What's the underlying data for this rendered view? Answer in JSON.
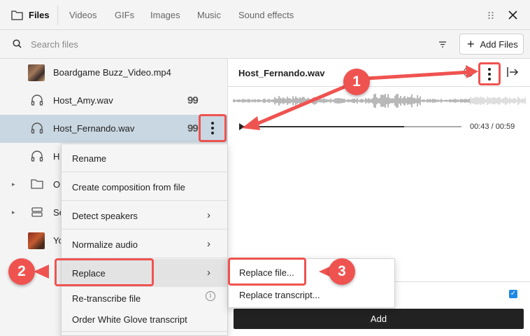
{
  "tabs": [
    {
      "label": "Files"
    },
    {
      "label": "Videos"
    },
    {
      "label": "GIFs"
    },
    {
      "label": "Images"
    },
    {
      "label": "Music"
    },
    {
      "label": "Sound effects"
    }
  ],
  "search": {
    "placeholder": "Search files"
  },
  "add_files_label": "Add Files",
  "files": [
    {
      "name": "Boardgame Buzz_Video.mp4",
      "type": "video-thumb"
    },
    {
      "name": "Host_Amy.wav",
      "type": "audio",
      "badge": "99"
    },
    {
      "name": "Host_Fernando.wav",
      "type": "audio",
      "badge": "99",
      "selected": true
    },
    {
      "name": "H",
      "type": "audio"
    },
    {
      "name": "O",
      "type": "folder"
    },
    {
      "name": "Se",
      "type": "sequence"
    },
    {
      "name": "Yo",
      "type": "video-thumb"
    }
  ],
  "detail": {
    "title": "Host_Fernando.wav",
    "timecode": "00:43 / 00:59",
    "progress": 0.74,
    "add_label": "Add"
  },
  "context_menu": {
    "items": [
      {
        "label": "Rename"
      },
      {
        "label": "Create composition from file"
      },
      {
        "label": "Detect speakers",
        "chevron": true
      },
      {
        "label": "Normalize audio",
        "chevron": true
      },
      {
        "label": "Replace",
        "chevron": true
      },
      {
        "label": "Re-transcribe file",
        "info": true
      },
      {
        "label": "Order White Glove transcript"
      }
    ]
  },
  "submenu": {
    "items": [
      {
        "label": "Replace file..."
      },
      {
        "label": "Replace transcript..."
      }
    ]
  },
  "annotations": {
    "badge_1": "1",
    "badge_2": "2",
    "badge_3": "3",
    "color": "#ef5350"
  },
  "icons": {
    "folder": "folder-icon",
    "grid": "grid-dots-icon",
    "close": "close-icon",
    "search": "search-icon",
    "filter": "filter-icon",
    "plus": "plus-icon",
    "headphones": "headphones-icon",
    "caret": "caret-right-icon",
    "chevron": "chevron-right-icon",
    "info": "info-icon",
    "exit": "exit-panel-icon",
    "check": "check-icon"
  }
}
